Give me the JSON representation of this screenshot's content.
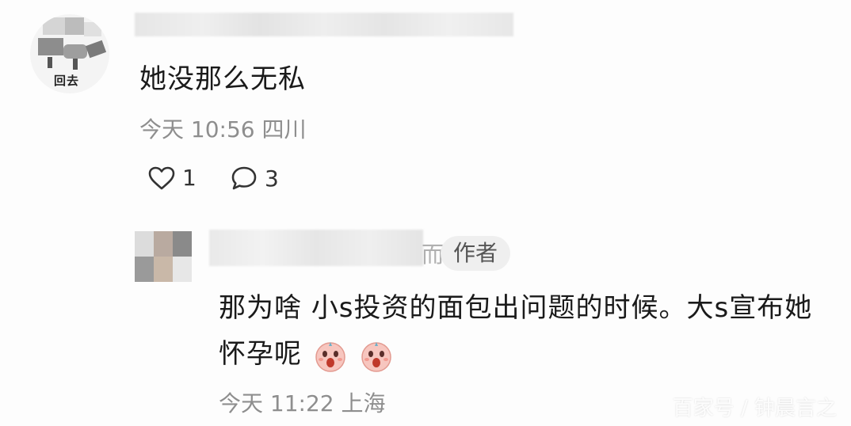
{
  "comment": {
    "avatar_caption": "回去",
    "text": "她没那么无私",
    "time": "今天 10:56",
    "location": "四川",
    "likes": "1",
    "replies": "3"
  },
  "reply": {
    "name_suffix": "而",
    "author_tag": "作者",
    "text": "那为啥 小s投资的面包出问题的时候。大s宣布她怀孕呢",
    "time": "今天 11:22",
    "location": "上海"
  },
  "icons": {
    "like": "heart-outline-icon",
    "comment": "speech-bubble-icon",
    "emoji": "shocked-face-emoji"
  },
  "watermark": "百家号 / 钟晨言之"
}
